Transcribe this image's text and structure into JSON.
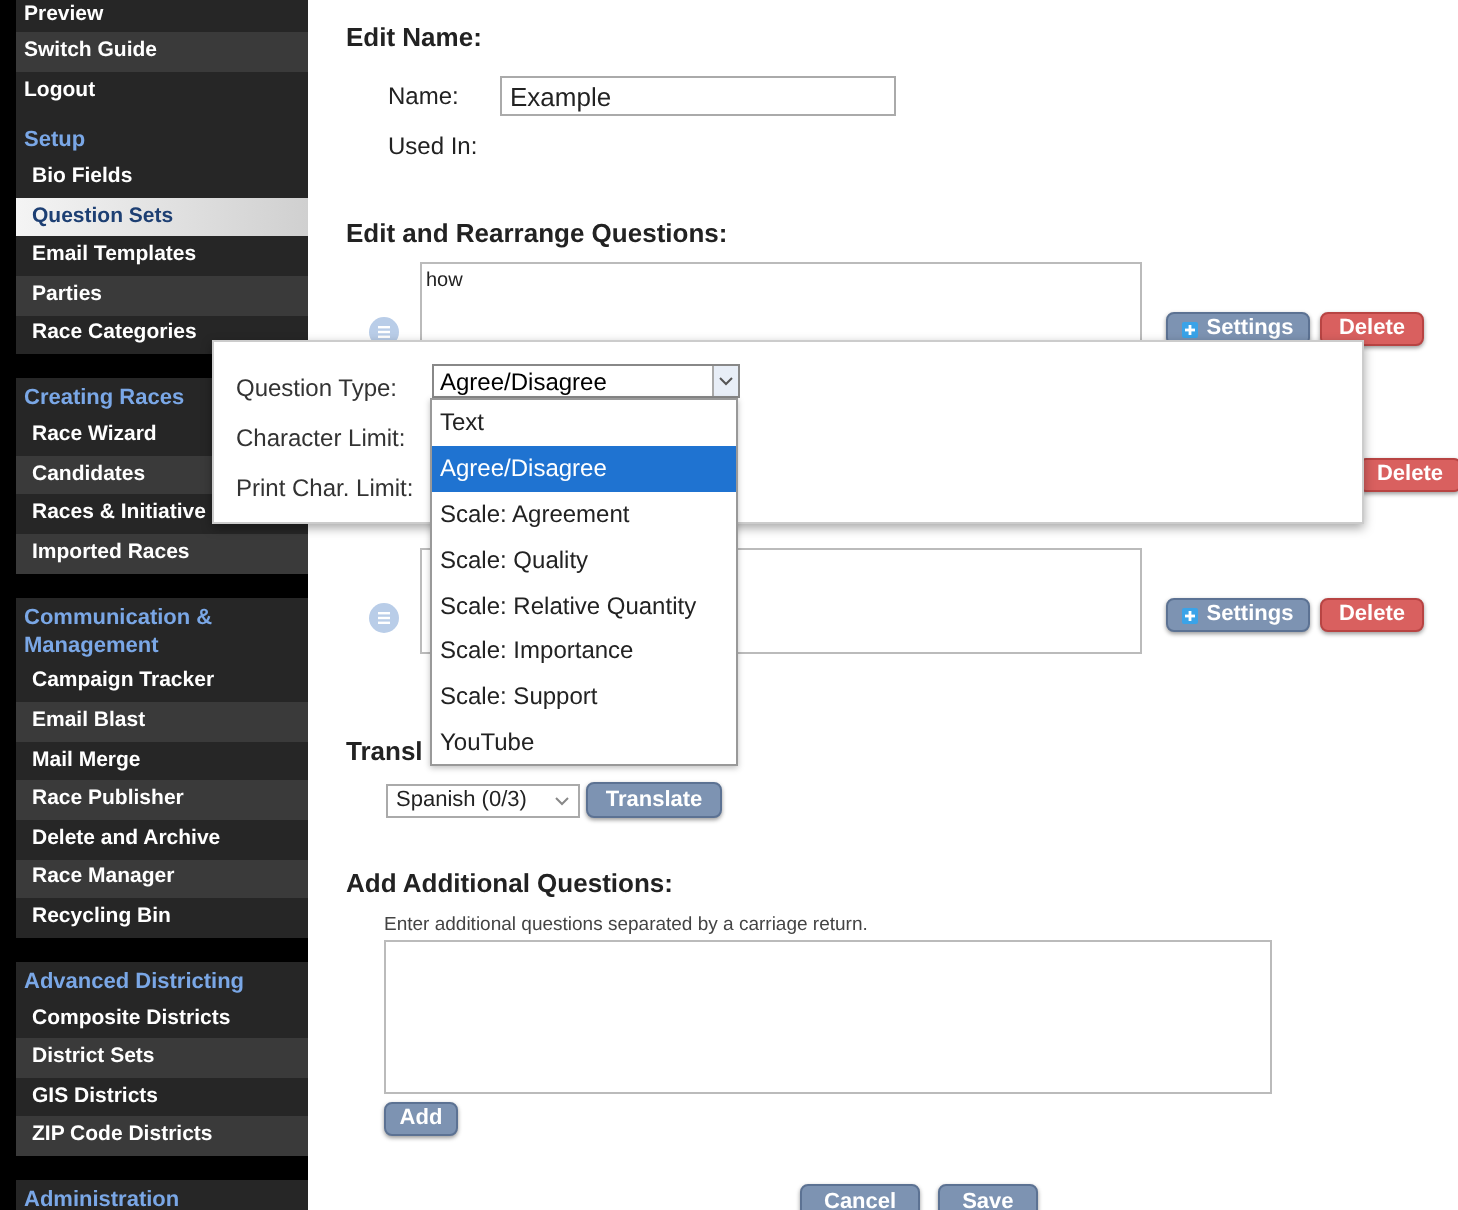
{
  "sidebar": {
    "groups": [
      {
        "items": [
          {
            "label": "Preview",
            "selected": false
          },
          {
            "label": "Switch Guide",
            "selected": false
          },
          {
            "label": "Logout",
            "selected": false
          }
        ]
      },
      {
        "title": "Setup",
        "items": [
          {
            "label": "Bio Fields",
            "selected": false
          },
          {
            "label": "Question Sets",
            "selected": true
          },
          {
            "label": "Email Templates",
            "selected": false
          },
          {
            "label": "Parties",
            "selected": false
          },
          {
            "label": "Race Categories",
            "selected": false
          }
        ]
      },
      {
        "title": "Creating Races",
        "items": [
          {
            "label": "Race Wizard",
            "selected": false
          },
          {
            "label": "Candidates",
            "selected": false
          },
          {
            "label": "Races & Initiative",
            "selected": false
          },
          {
            "label": "Imported Races",
            "selected": false
          }
        ]
      },
      {
        "title": "Communication & Management",
        "items": [
          {
            "label": "Campaign Tracker",
            "selected": false
          },
          {
            "label": "Email Blast",
            "selected": false
          },
          {
            "label": "Mail Merge",
            "selected": false
          },
          {
            "label": "Race Publisher",
            "selected": false
          },
          {
            "label": "Delete and Archive",
            "selected": false
          },
          {
            "label": "Race Manager",
            "selected": false
          },
          {
            "label": "Recycling Bin",
            "selected": false
          }
        ]
      },
      {
        "title": "Advanced Districting",
        "items": [
          {
            "label": "Composite Districts",
            "selected": false
          },
          {
            "label": "District Sets",
            "selected": false
          },
          {
            "label": "GIS Districts",
            "selected": false
          },
          {
            "label": "ZIP Code Districts",
            "selected": false
          }
        ]
      },
      {
        "title": "Administration"
      }
    ]
  },
  "edit_name": {
    "heading": "Edit Name:",
    "name_label": "Name:",
    "name_value": "Example",
    "used_in_label": "Used In:"
  },
  "questions_section": {
    "heading": "Edit and Rearrange Questions:",
    "questions": [
      {
        "kind": "full",
        "text": "how",
        "settings_button": "Settings",
        "delete_button": "Delete"
      },
      {
        "kind": "covered",
        "delete_button": "Delete"
      },
      {
        "kind": "full",
        "settings_button": "Settings",
        "delete_button": "Delete"
      }
    ]
  },
  "translate": {
    "heading": "Transl",
    "language": "Spanish (0/3)",
    "button": "Translate"
  },
  "add_questions": {
    "heading": "Add Additional Questions:",
    "hint": "Enter additional questions separated by a carriage return.",
    "button": "Add"
  },
  "footer_buttons": [
    "Cancel",
    "Save"
  ],
  "settings_popup": {
    "question_type_label": "Question Type:",
    "question_type_value": "Agree/Disagree",
    "character_limit_label": "Character Limit:",
    "print_char_limit_label": "Print Char. Limit:",
    "options": [
      {
        "label": "Text",
        "selected": false
      },
      {
        "label": "Agree/Disagree",
        "selected": true
      },
      {
        "label": "Scale: Agreement",
        "selected": false
      },
      {
        "label": "Scale: Quality",
        "selected": false
      },
      {
        "label": "Scale: Relative Quantity",
        "selected": false
      },
      {
        "label": "Scale: Importance",
        "selected": false
      },
      {
        "label": "Scale: Support",
        "selected": false
      },
      {
        "label": "YouTube",
        "selected": false
      }
    ]
  }
}
